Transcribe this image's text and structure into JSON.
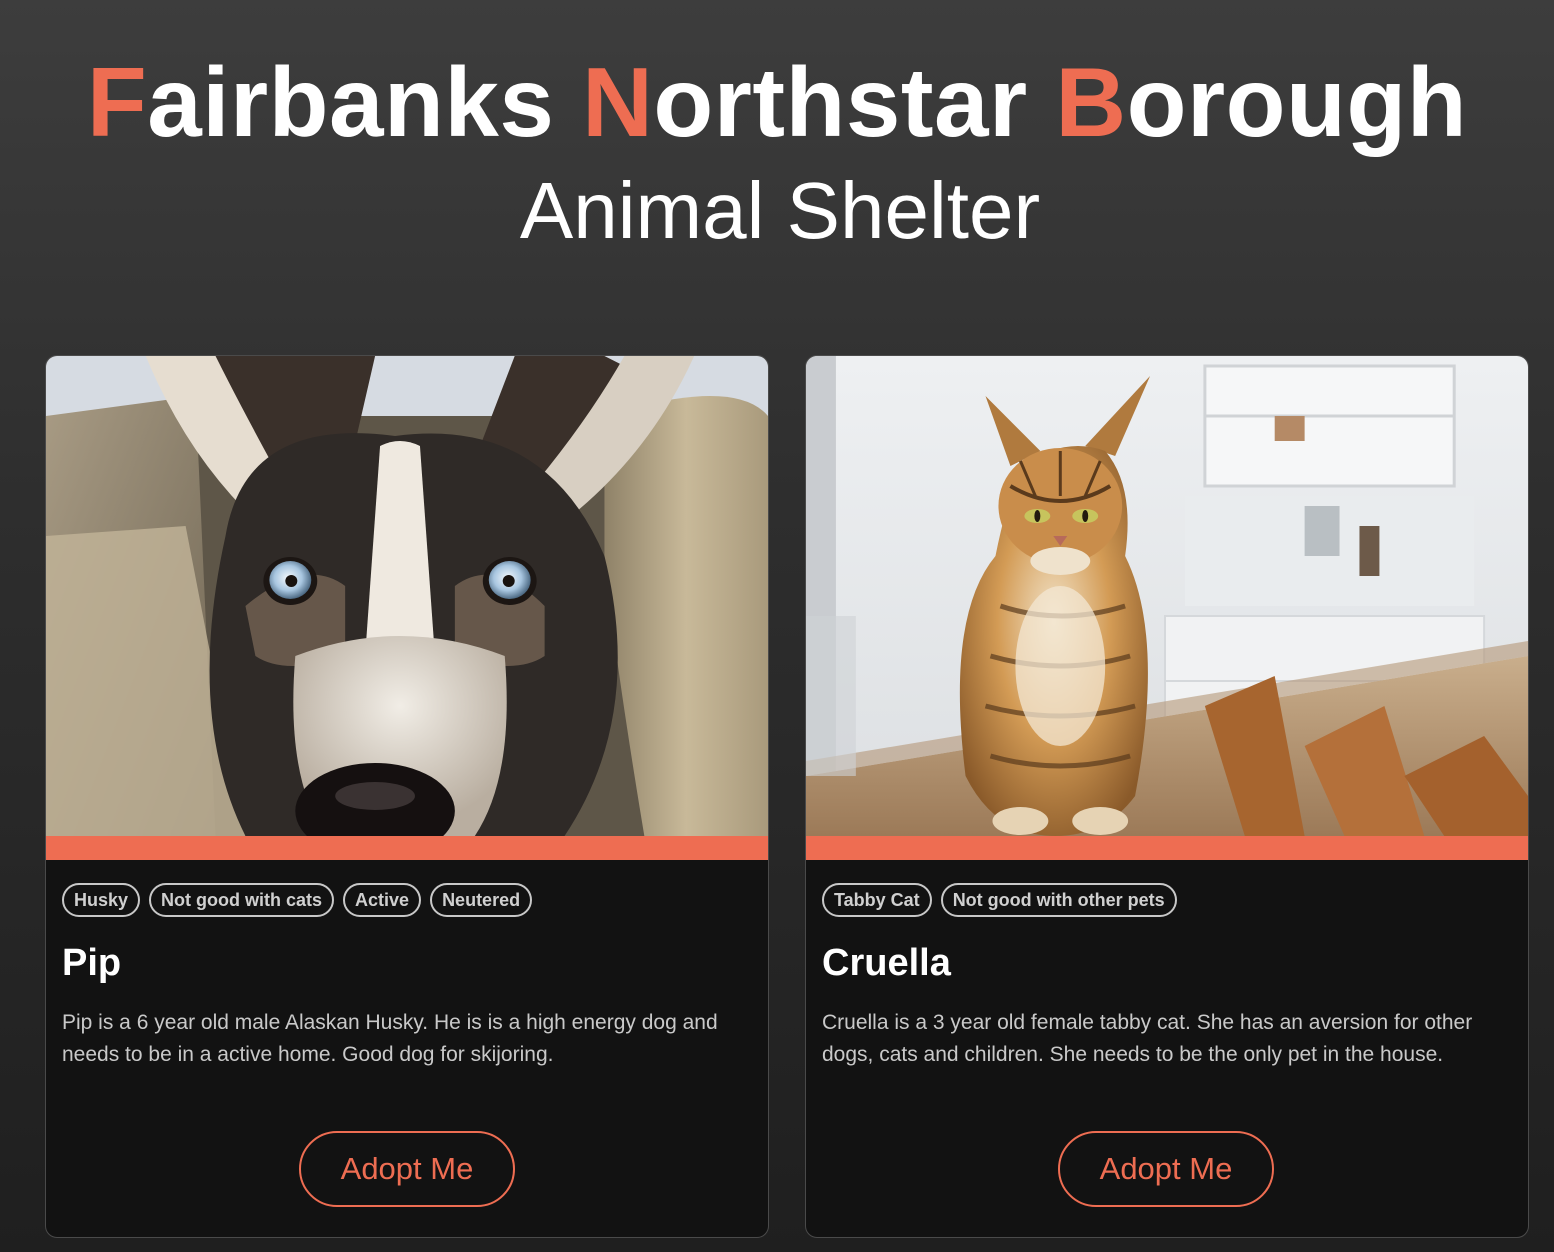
{
  "header": {
    "title_words": [
      {
        "initial": "F",
        "rest": "airbanks"
      },
      {
        "initial": "N",
        "rest": "orthstar"
      },
      {
        "initial": "B",
        "rest": "orough"
      }
    ],
    "subtitle": "Animal Shelter"
  },
  "colors": {
    "accent": "#ee6d52",
    "card_bg": "#121212",
    "page_bg": "#2e2e2e"
  },
  "pets": [
    {
      "name": "Pip",
      "photo_icon": "husky-photo",
      "tags": [
        "Husky",
        "Not good with cats",
        "Active",
        "Neutered"
      ],
      "description": "Pip is a 6 year old male Alaskan Husky. He is is a high energy dog and needs to be in a active home. Good dog for skijoring.",
      "button_label": "Adopt Me"
    },
    {
      "name": "Cruella",
      "photo_icon": "tabby-cat-photo",
      "tags": [
        "Tabby Cat",
        "Not good with other pets"
      ],
      "description": "Cruella is a 3 year old female tabby cat. She has an aversion for other dogs, cats and children. She needs to be the only pet in the house.",
      "button_label": "Adopt Me"
    }
  ]
}
